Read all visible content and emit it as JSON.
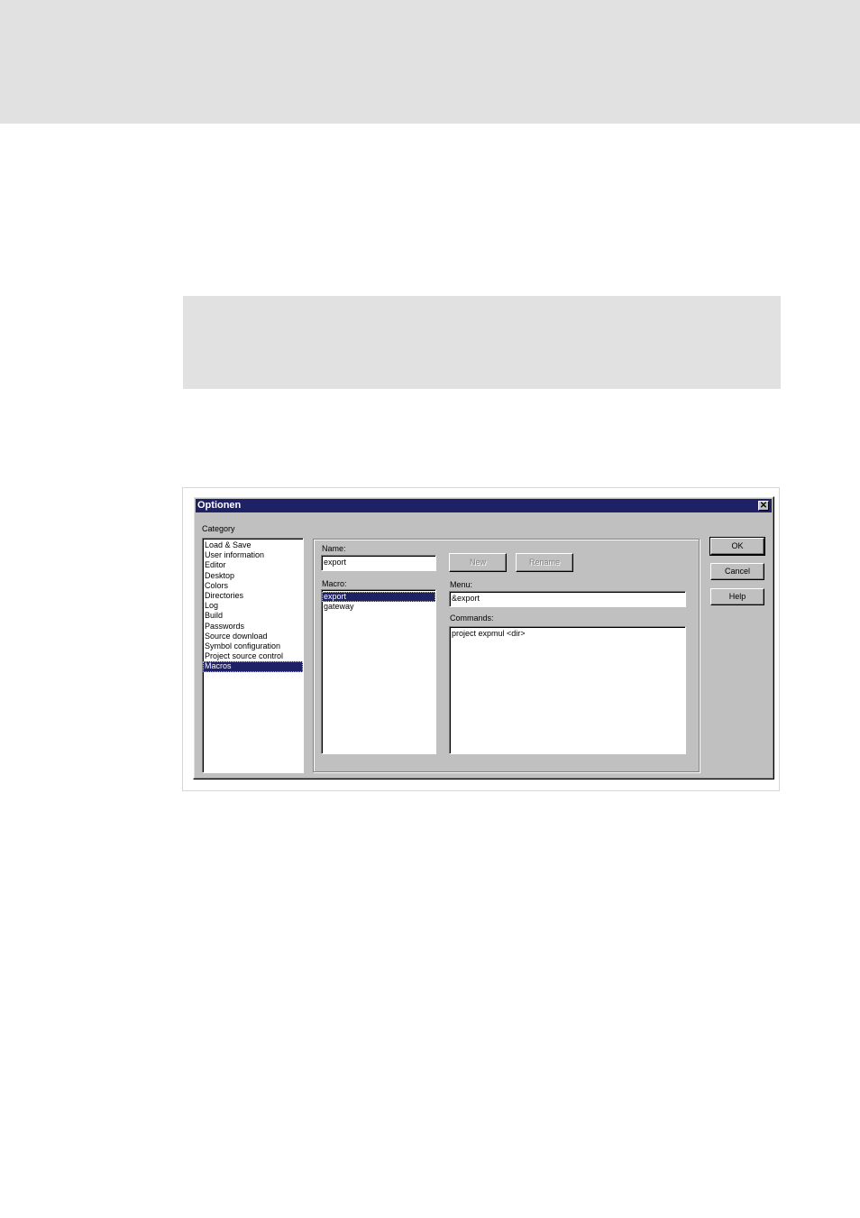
{
  "dialog": {
    "title": "Optionen",
    "close_glyph": "✕",
    "category_label": "Category",
    "categories": [
      "Load & Save",
      "User information",
      "Editor",
      "Desktop",
      "Colors",
      "Directories",
      "Log",
      "Build",
      "Passwords",
      "Source download",
      "Symbol configuration",
      "Project source control",
      "Macros"
    ],
    "selected_category": "Macros",
    "name_label": "Name:",
    "name_value": "export",
    "new_button": "New",
    "rename_button": "Rename",
    "macro_label": "Macro:",
    "macros": [
      "export",
      "gateway"
    ],
    "selected_macro": "export",
    "menu_label": "Menu:",
    "menu_value": "&export",
    "commands_label": "Commands:",
    "commands_value": "project expmul <dir>",
    "ok_button": "OK",
    "cancel_button": "Cancel",
    "help_button": "Help"
  },
  "colors": {
    "titlebar": "#1f2166",
    "dialog_face": "#c0c0c0",
    "selection": "#1f2166",
    "page_band": "#e1e1e1"
  }
}
